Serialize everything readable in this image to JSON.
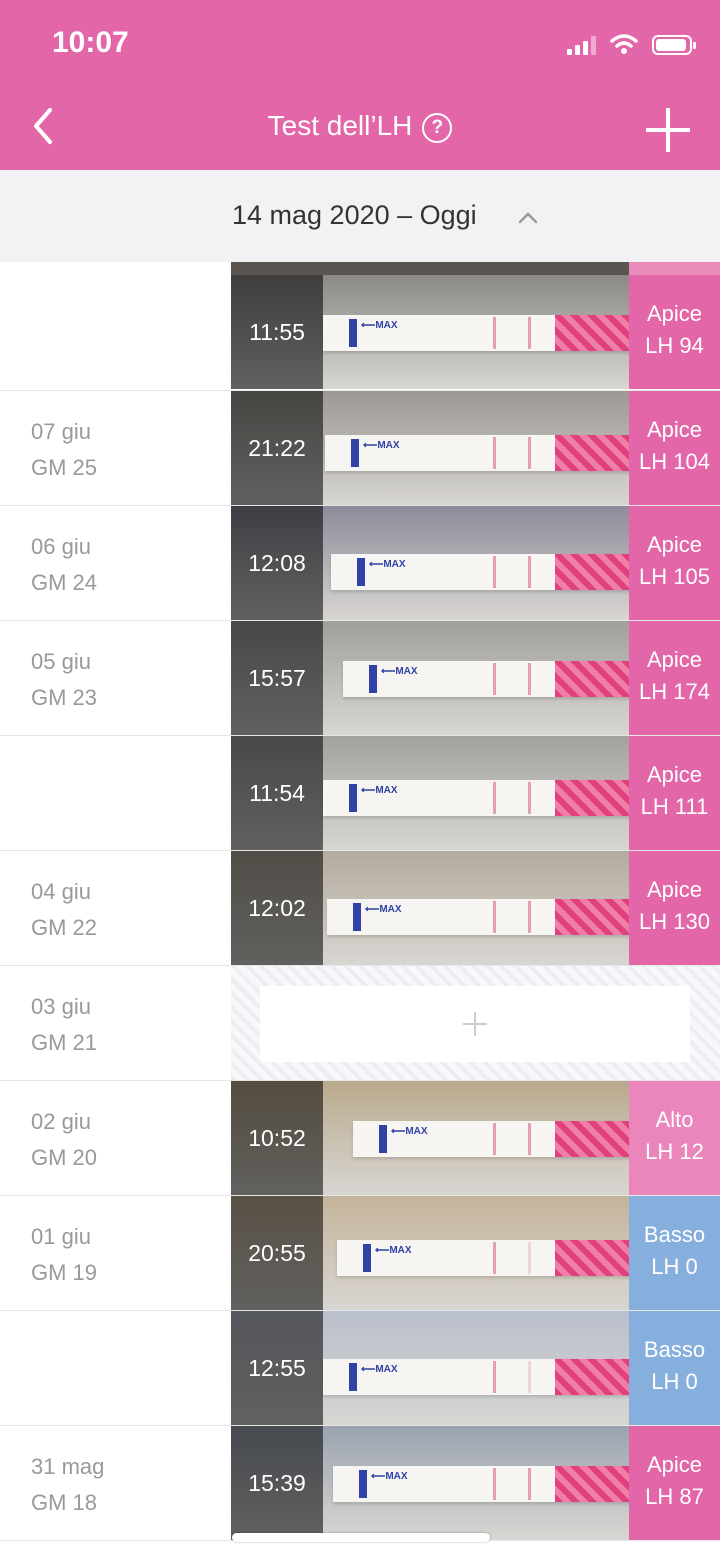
{
  "status": {
    "time": "10:07"
  },
  "nav": {
    "title": "Test dell’LH",
    "help_glyph": "?"
  },
  "date_header": {
    "text": "14 mag 2020 – Oggi"
  },
  "colors": {
    "brand": "#e366a9",
    "peak": "#e366a9",
    "high": "#eb86bc",
    "low": "#86afdd"
  },
  "rows": [
    {
      "date": "",
      "cycle_day": "",
      "entries": [
        {
          "time": "11:55",
          "level": "Apice",
          "value": "LH 94",
          "status": "peak"
        }
      ]
    },
    {
      "date": "07 giu",
      "cycle_day": "GM 25",
      "entries": [
        {
          "time": "21:22",
          "level": "Apice",
          "value": "LH 104",
          "status": "peak"
        }
      ]
    },
    {
      "date": "06 giu",
      "cycle_day": "GM 24",
      "entries": [
        {
          "time": "12:08",
          "level": "Apice",
          "value": "LH 105",
          "status": "peak"
        }
      ]
    },
    {
      "date": "05 giu",
      "cycle_day": "GM 23",
      "entries": [
        {
          "time": "15:57",
          "level": "Apice",
          "value": "LH 174",
          "status": "peak"
        },
        {
          "time": "11:54",
          "level": "Apice",
          "value": "LH 111",
          "status": "peak"
        }
      ]
    },
    {
      "date": "04 giu",
      "cycle_day": "GM 22",
      "entries": [
        {
          "time": "12:02",
          "level": "Apice",
          "value": "LH 130",
          "status": "peak"
        }
      ]
    },
    {
      "date": "03 giu",
      "cycle_day": "GM 21",
      "entries": []
    },
    {
      "date": "02 giu",
      "cycle_day": "GM 20",
      "entries": [
        {
          "time": "10:52",
          "level": "Alto",
          "value": "LH 12",
          "status": "high"
        }
      ]
    },
    {
      "date": "01 giu",
      "cycle_day": "GM 19",
      "entries": [
        {
          "time": "20:55",
          "level": "Basso",
          "value": "LH 0",
          "status": "low"
        },
        {
          "time": "12:55",
          "level": "Basso",
          "value": "LH 0",
          "status": "low"
        }
      ]
    },
    {
      "date": "31 mag",
      "cycle_day": "GM 18",
      "entries": [
        {
          "time": "15:39",
          "level": "Apice",
          "value": "LH 87",
          "status": "peak"
        }
      ]
    }
  ],
  "strip_label": "⟵MAX"
}
